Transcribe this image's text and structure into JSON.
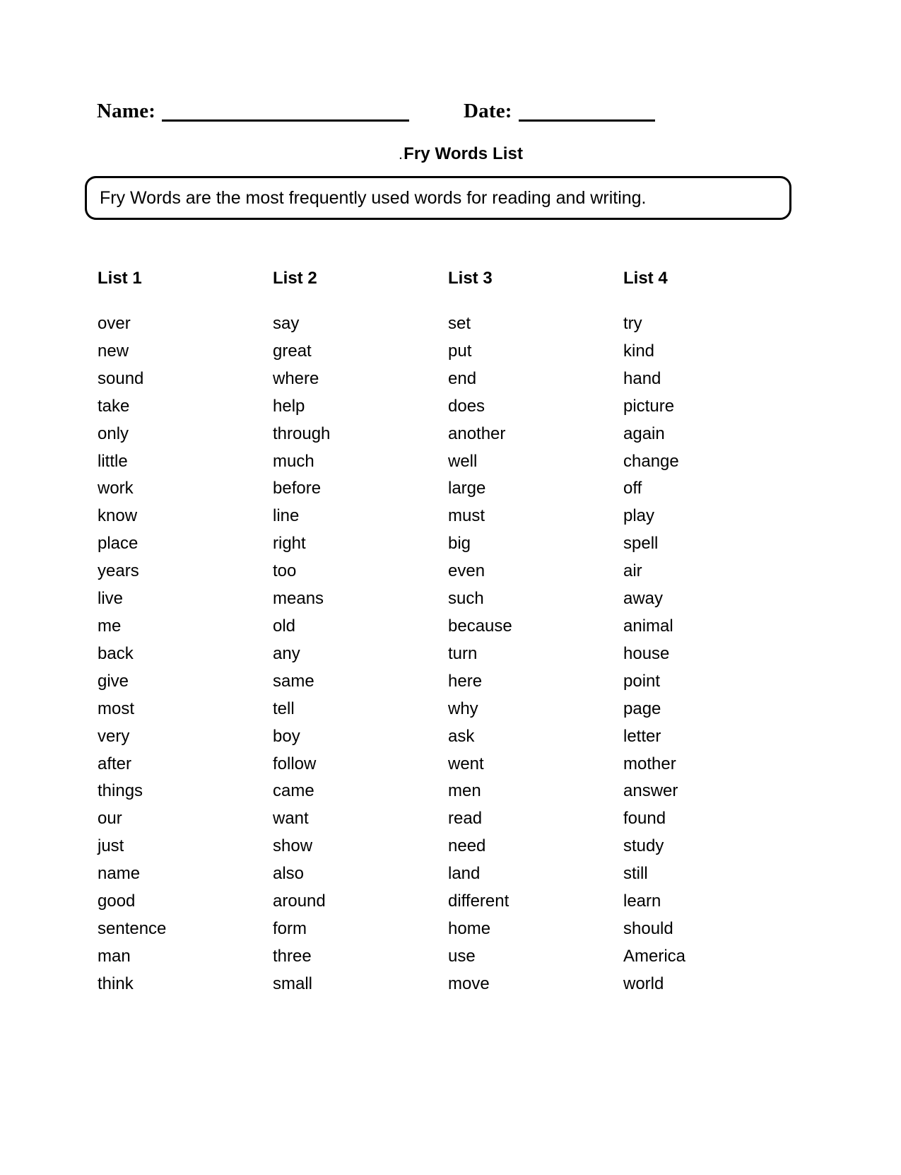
{
  "worksheet": {
    "name_label": "Name:",
    "date_label": "Date:",
    "title_prefix": ".",
    "title": "Fry Words List",
    "instruction": "Fry Words are the most frequently used words for reading and writing."
  },
  "columns": [
    {
      "heading": "List 1",
      "words": [
        "over",
        "new",
        "sound",
        "take",
        "only",
        "little",
        "work",
        "know",
        "place",
        "years",
        "live",
        "me",
        "back",
        "give",
        "most",
        "very",
        "after",
        "things",
        "our",
        "just",
        "name",
        "good",
        "sentence",
        "man",
        "think"
      ]
    },
    {
      "heading": "List 2",
      "words": [
        "say",
        "great",
        "where",
        "help",
        "through",
        "much",
        "before",
        "line",
        "right",
        "too",
        "means",
        "old",
        "any",
        "same",
        "tell",
        "boy",
        "follow",
        "came",
        "want",
        "show",
        "also",
        "around",
        "form",
        "three",
        "small"
      ]
    },
    {
      "heading": "List 3",
      "words": [
        "set",
        "put",
        "end",
        "does",
        "another",
        "well",
        "large",
        "must",
        "big",
        "even",
        "such",
        "because",
        "turn",
        "here",
        "why",
        "ask",
        "went",
        "men",
        "read",
        "need",
        "land",
        "different",
        "home",
        "use",
        "move"
      ]
    },
    {
      "heading": "List 4",
      "words": [
        "try",
        "kind",
        "hand",
        "picture",
        "again",
        "change",
        "off",
        "play",
        "spell",
        "air",
        "away",
        "animal",
        "house",
        "point",
        "page",
        "letter",
        "mother",
        "answer",
        "found",
        "study",
        "still",
        "learn",
        "should",
        "America",
        "world"
      ]
    }
  ],
  "colors": {
    "ink": "#000000",
    "paper": "#ffffff"
  }
}
